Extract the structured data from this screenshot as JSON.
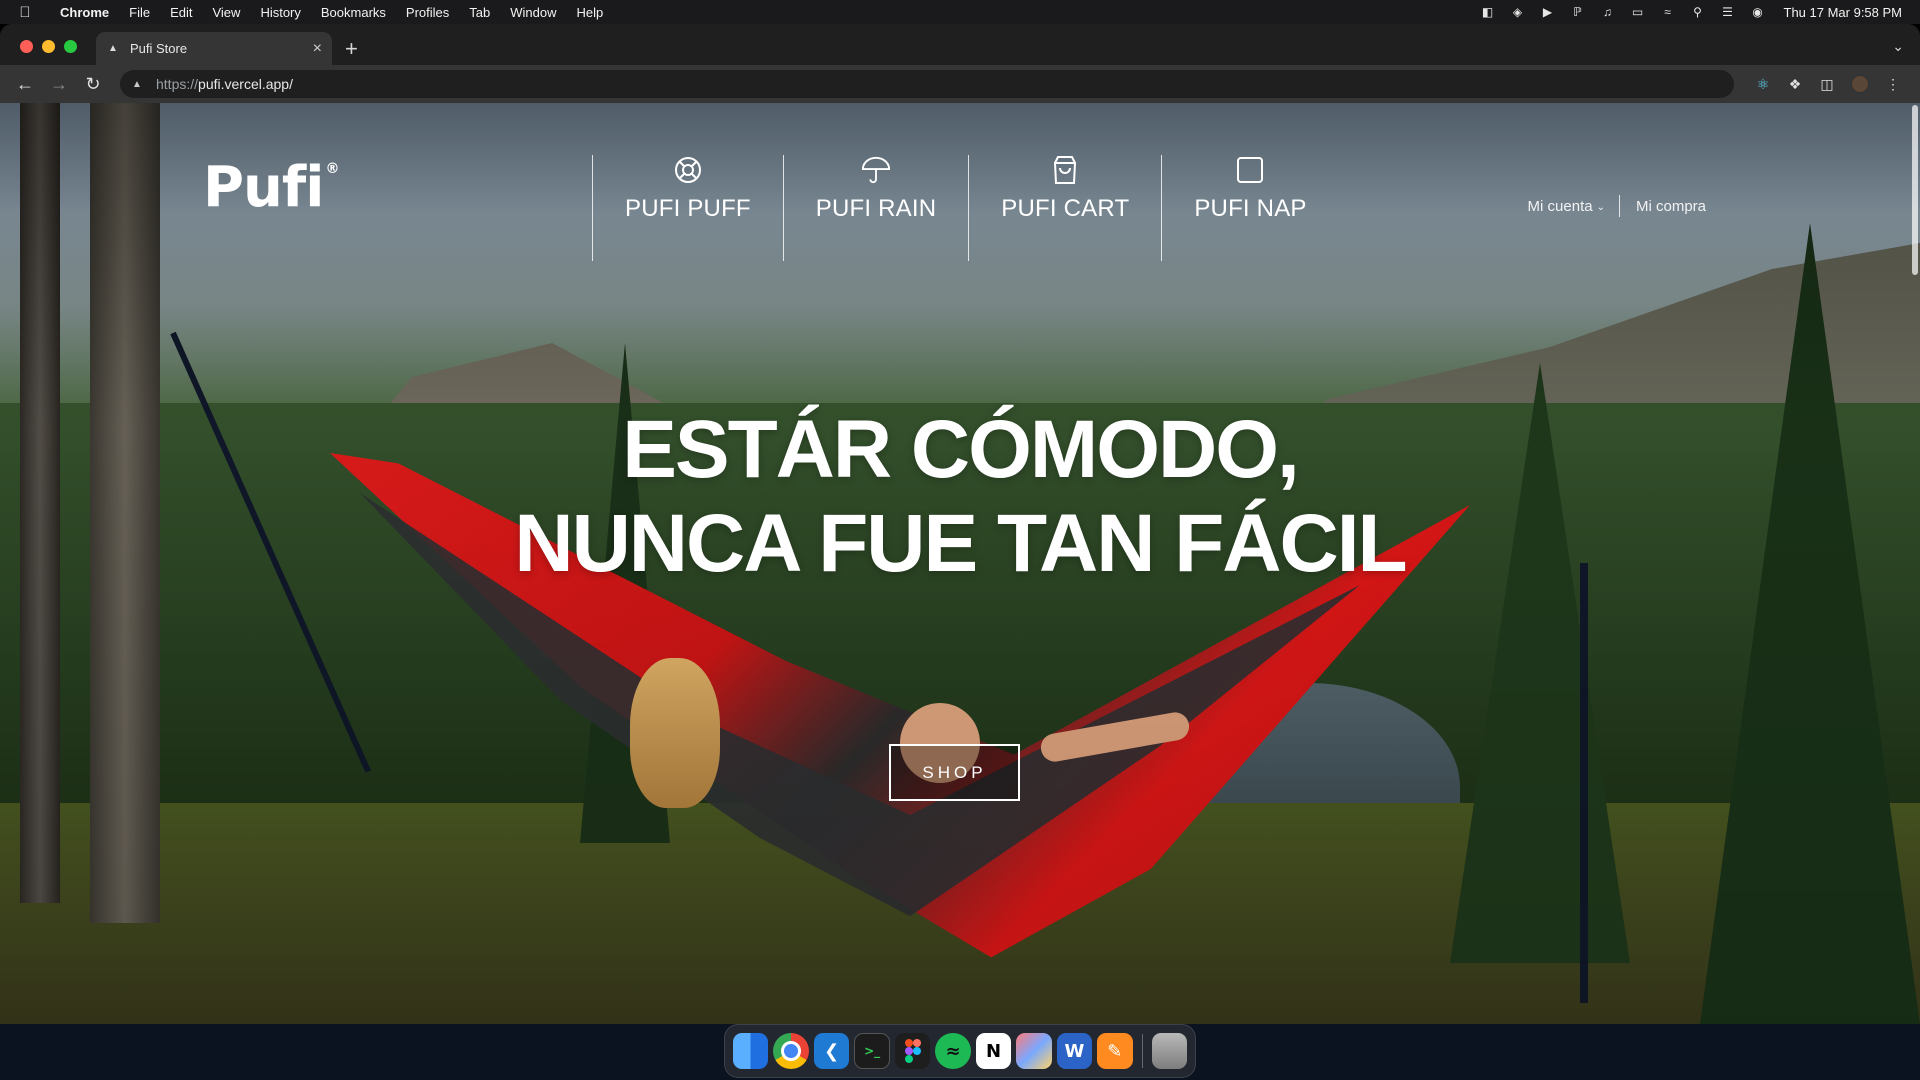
{
  "menubar": {
    "app_name": "Chrome",
    "menus": [
      "File",
      "Edit",
      "View",
      "History",
      "Bookmarks",
      "Profiles",
      "Tab",
      "Window",
      "Help"
    ],
    "clock": "Thu 17 Mar  9:58 PM"
  },
  "browser": {
    "tab_title": "Pufi Store",
    "url_scheme": "https://",
    "url_host": "pufi.vercel.app/"
  },
  "site": {
    "logo": "Pufi",
    "logo_mark": "®",
    "nav": [
      {
        "label": "PUFI PUFF",
        "icon": "lifebuoy-icon"
      },
      {
        "label": "PUFI RAIN",
        "icon": "umbrella-icon"
      },
      {
        "label": "PUFI CART",
        "icon": "shopping-bag-icon"
      },
      {
        "label": "PUFI NAP",
        "icon": "square-icon"
      }
    ],
    "account_label": "Mi cuenta",
    "purchase_label": "Mi compra"
  },
  "hero": {
    "title_line1": "ESTÁR CÓMODO,",
    "title_line2": "NUNCA FUE TAN FÁCIL",
    "cta_label": "SHOP"
  },
  "dock": {
    "apps": [
      "Finder",
      "Google Chrome",
      "Visual Studio Code",
      "Terminal",
      "Figma",
      "Spotify",
      "Notion",
      "Launchpad",
      "Microsoft Word",
      "Pages",
      "Trash"
    ]
  }
}
